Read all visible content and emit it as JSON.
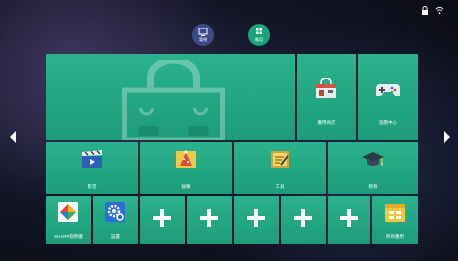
{
  "status": {
    "lock_icon": "lock-icon",
    "wifi_icon": "wifi-icon"
  },
  "top_tabs": [
    {
      "label": "電視",
      "icon": "tv-icon"
    },
    {
      "label": "應用",
      "icon": "grid-icon"
    }
  ],
  "row1": {
    "big_tile_icon": "shopping-bag-icon",
    "app_store": {
      "label": "應用商店",
      "icon": "store-icon"
    },
    "game_center": {
      "label": "遊戲中心",
      "icon": "gamepad-icon"
    }
  },
  "row2": [
    {
      "label": "影音",
      "icon": "clapperboard-icon"
    },
    {
      "label": "娛樂",
      "icon": "party-hat-icon"
    },
    {
      "label": "工具",
      "icon": "tools-icon"
    },
    {
      "label": "教育",
      "icon": "graduation-cap-icon"
    }
  ],
  "row3": {
    "sharp_app": {
      "label": "SHARP說明書",
      "icon": "sharp-logo-icon"
    },
    "settings": {
      "label": "設置",
      "icon": "settings-gear-icon"
    },
    "add_slots": [
      {
        "icon": "plus-icon"
      },
      {
        "icon": "plus-icon"
      },
      {
        "icon": "plus-icon"
      },
      {
        "icon": "plus-icon"
      },
      {
        "icon": "plus-icon"
      }
    ],
    "all_apps": {
      "label": "所有應用",
      "icon": "all-apps-icon"
    }
  },
  "nav": {
    "left_arrow": "left-arrow-icon",
    "right_arrow": "right-arrow-icon"
  },
  "colors": {
    "tile": "#22a683",
    "tab_tv": "#3c4a8a",
    "tab_app": "#1aa47c"
  }
}
